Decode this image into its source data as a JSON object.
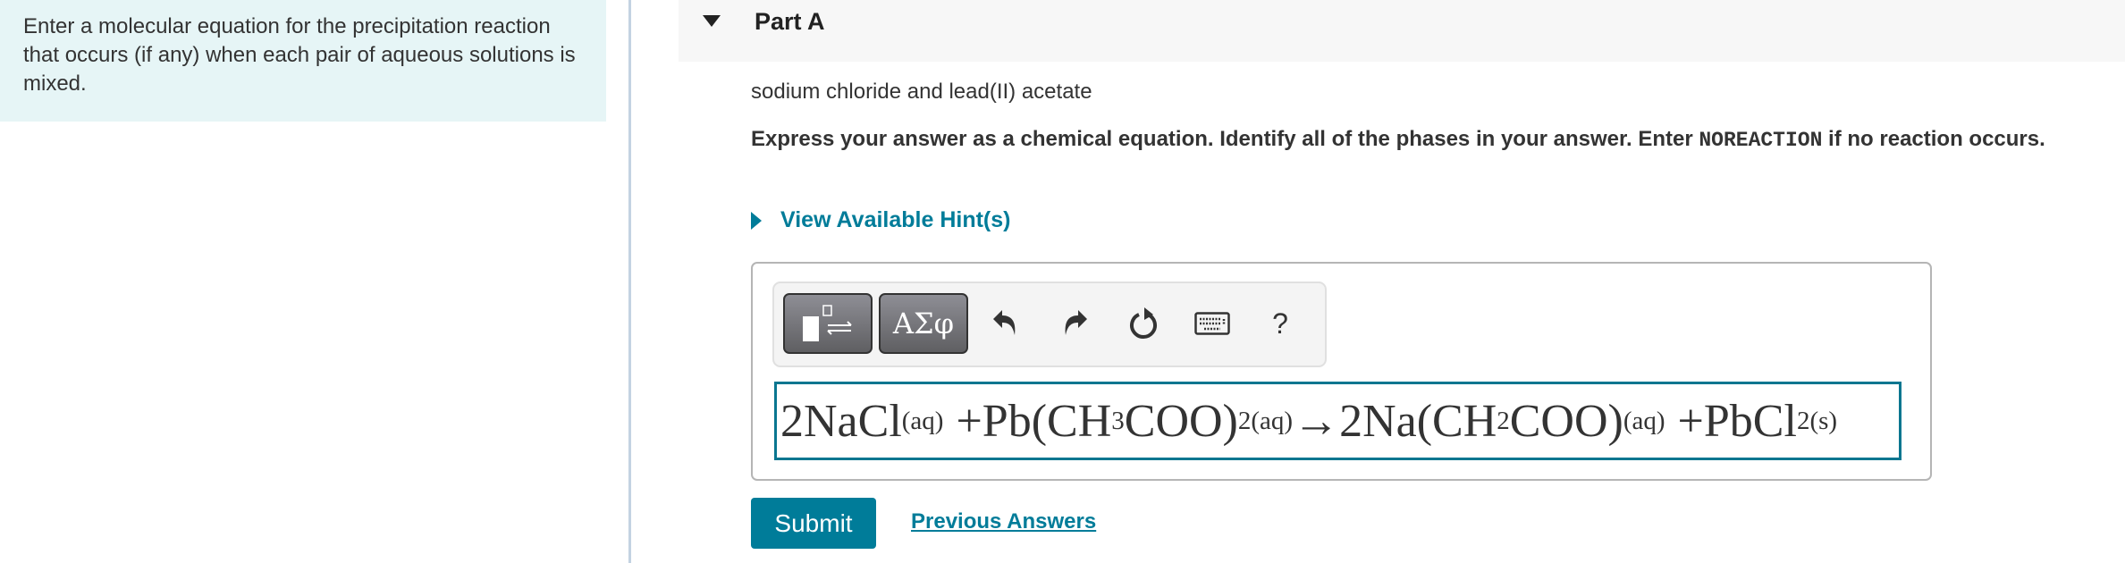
{
  "intro": {
    "text": "Enter a molecular equation for the precipitation reaction that occurs (if any) when each pair of aqueous solutions is mixed."
  },
  "part": {
    "title": "Part A",
    "caret_icon": "caret-down-icon",
    "question": "sodium chloride and lead(II) acetate",
    "instructions": {
      "before": "Express your answer as a chemical equation. Identify all of the phases in your answer. Enter ",
      "code": "NOREACTION",
      "after": " if no reaction occurs."
    },
    "hint_label": "View Available Hint(s)"
  },
  "toolbar": {
    "templates_icon": "templates-icon",
    "symbols_label": "ΑΣφ",
    "undo_icon": "undo-icon",
    "redo_icon": "redo-icon",
    "reset_icon": "reset-icon",
    "keyboard_icon": "keyboard-icon",
    "help_label": "?"
  },
  "answer": {
    "terms": [
      {
        "main": "2NaCl",
        "sub": "(aq)"
      },
      {
        "op": "+"
      },
      {
        "main": "Pb(CH",
        "sub": "3"
      },
      {
        "main": " COO)",
        "sub": "2(aq)"
      },
      {
        "op": "→"
      },
      {
        "main": "2Na(CH",
        "sub": "2"
      },
      {
        "main": " COO)",
        "sub": "(aq)"
      },
      {
        "op": "+"
      },
      {
        "main": "PbCl",
        "sub": "2(s)"
      }
    ]
  },
  "actions": {
    "submit_label": "Submit",
    "previous_answers_label": "Previous Answers"
  },
  "colors": {
    "accent": "#007c99",
    "intro_bg": "#e6f5f6",
    "header_bg": "#f7f7f7"
  }
}
